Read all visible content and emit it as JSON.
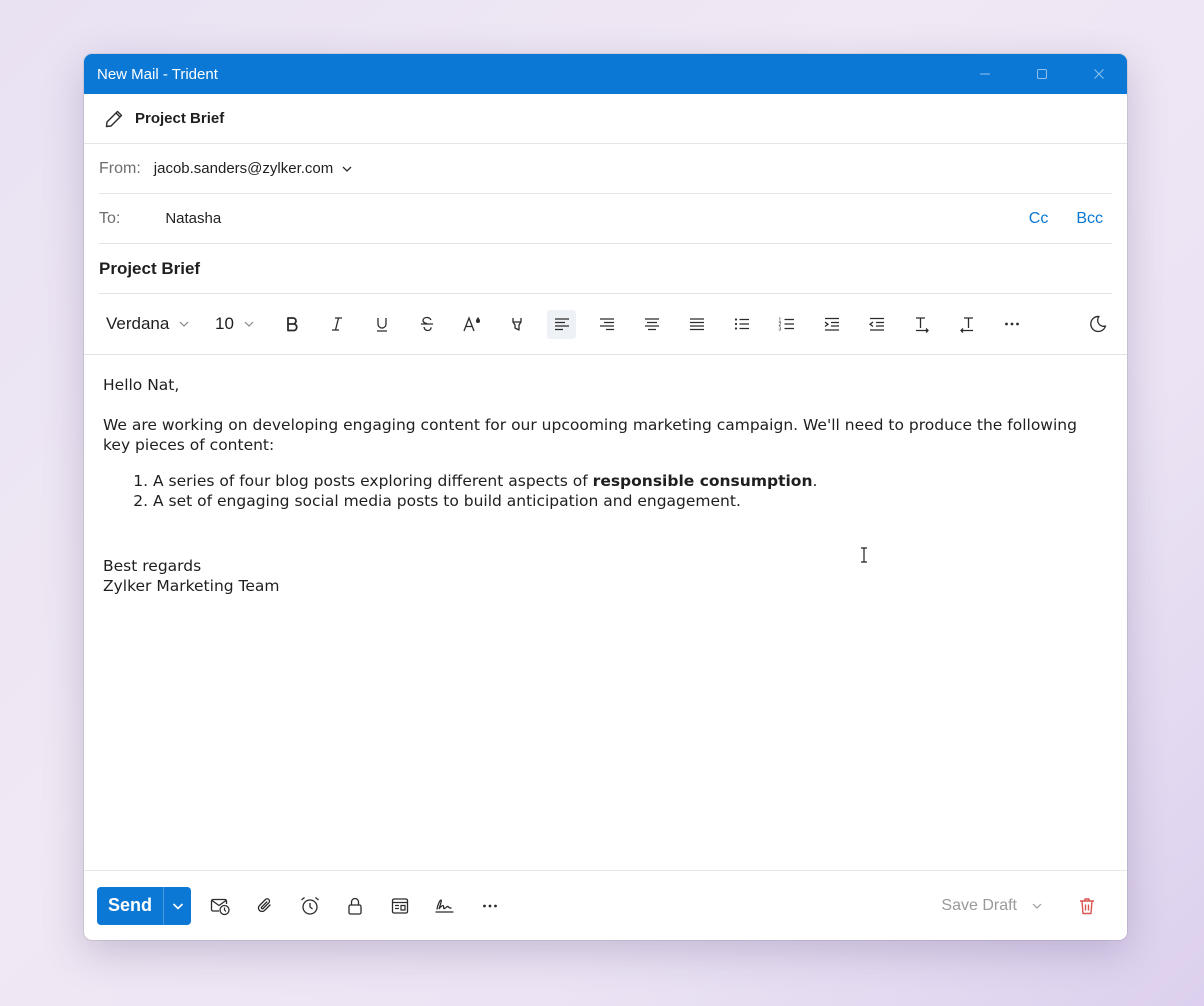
{
  "window": {
    "title": "New Mail - Trident"
  },
  "tab": {
    "label": "Project Brief"
  },
  "from": {
    "label": "From:",
    "value": "jacob.sanders@zylker.com"
  },
  "to": {
    "label": "To:",
    "value": "Natasha",
    "cc": "Cc",
    "bcc": "Bcc"
  },
  "subject": {
    "value": "Project Brief"
  },
  "toolbar": {
    "font": "Verdana",
    "size": "10"
  },
  "body": {
    "greeting": "Hello Nat,",
    "intro": "We are working on developing engaging content for our upcooming marketing campaign. We'll need to produce the following key pieces of content:",
    "item1_pre": "A series of four blog posts exploring different aspects of ",
    "item1_bold": "responsible consumption",
    "item1_post": ".",
    "item2": "A set of engaging social media posts to build anticipation and engagement.",
    "closing": "Best regards",
    "signature": "Zylker Marketing Team"
  },
  "footer": {
    "send": "Send",
    "save_draft": "Save Draft"
  },
  "colors": {
    "accent": "#0a78d4",
    "delete": "#d9534f"
  }
}
